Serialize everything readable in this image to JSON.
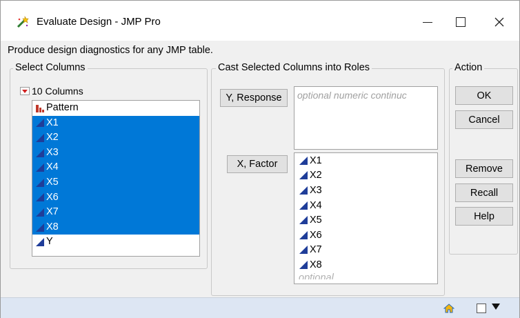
{
  "window": {
    "title": "Evaluate Design - JMP Pro",
    "icon": "jmp-wizard-icon"
  },
  "description": "Produce design diagnostics for any JMP table.",
  "select_columns": {
    "legend": "Select Columns",
    "header": "10 Columns",
    "columns": [
      {
        "label": "Pattern",
        "type": "nominal",
        "selected": false
      },
      {
        "label": "X1",
        "type": "continuous",
        "selected": true
      },
      {
        "label": "X2",
        "type": "continuous",
        "selected": true
      },
      {
        "label": "X3",
        "type": "continuous",
        "selected": true
      },
      {
        "label": "X4",
        "type": "continuous",
        "selected": true
      },
      {
        "label": "X5",
        "type": "continuous",
        "selected": true
      },
      {
        "label": "X6",
        "type": "continuous",
        "selected": true
      },
      {
        "label": "X7",
        "type": "continuous",
        "selected": true
      },
      {
        "label": "X8",
        "type": "continuous",
        "selected": true
      },
      {
        "label": "Y",
        "type": "continuous",
        "selected": false
      }
    ]
  },
  "cast_roles": {
    "legend": "Cast Selected Columns into Roles",
    "y_button": "Y, Response",
    "y_placeholder": "optional numeric continuc",
    "x_button": "X, Factor",
    "x_items": [
      "X1",
      "X2",
      "X3",
      "X4",
      "X5",
      "X6",
      "X7",
      "X8"
    ],
    "x_partial_item": "optional"
  },
  "action": {
    "legend": "Action",
    "ok": "OK",
    "cancel": "Cancel",
    "remove": "Remove",
    "recall": "Recall",
    "help": "Help"
  },
  "colors": {
    "selection": "#0078d7",
    "continuous_icon": "#1f3d99",
    "nominal_icon": "#c0392b",
    "statusbar": "#dde6f3"
  }
}
